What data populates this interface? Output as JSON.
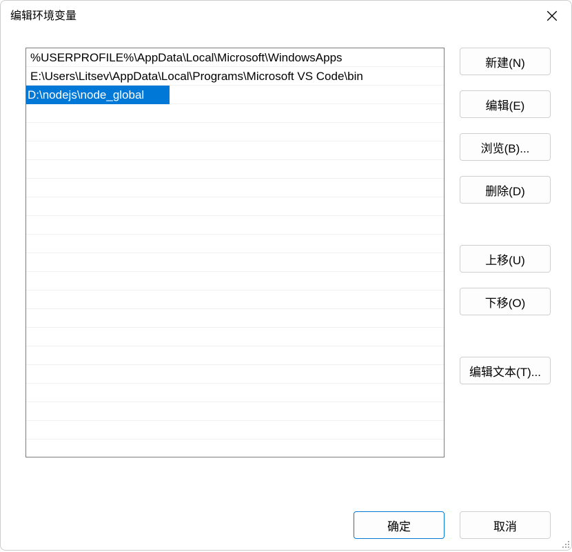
{
  "dialog": {
    "title": "编辑环境变量"
  },
  "list": {
    "items": [
      "%USERPROFILE%\\AppData\\Local\\Microsoft\\WindowsApps",
      "E:\\Users\\Litsev\\AppData\\Local\\Programs\\Microsoft VS Code\\bin"
    ],
    "editing_value": "D:\\nodejs\\node_global"
  },
  "buttons": {
    "new": "新建(N)",
    "edit": "编辑(E)",
    "browse": "浏览(B)...",
    "delete": "删除(D)",
    "move_up": "上移(U)",
    "move_down": "下移(O)",
    "edit_text": "编辑文本(T)...",
    "ok": "确定",
    "cancel": "取消"
  }
}
